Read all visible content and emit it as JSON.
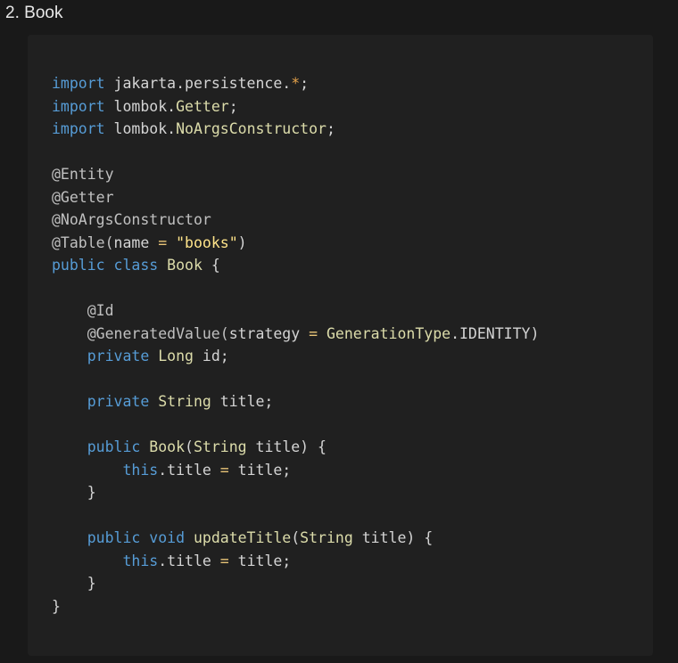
{
  "heading": {
    "number": "2.",
    "title": "Book"
  },
  "colors": {
    "background": "#191919",
    "code_background": "#202020",
    "keyword": "#569cd6",
    "type": "#dcdcaa",
    "plain": "#d4d4d4",
    "string": "#ffe48a"
  },
  "code": {
    "language": "java",
    "lines": [
      [
        {
          "t": "import",
          "k": "kw"
        },
        {
          "t": " jakarta.persistence.",
          "k": "plain"
        },
        {
          "t": "*",
          "k": "star"
        },
        {
          "t": ";",
          "k": "plain"
        }
      ],
      [
        {
          "t": "import",
          "k": "kw"
        },
        {
          "t": " lombok.",
          "k": "plain"
        },
        {
          "t": "Getter",
          "k": "type"
        },
        {
          "t": ";",
          "k": "plain"
        }
      ],
      [
        {
          "t": "import",
          "k": "kw"
        },
        {
          "t": " lombok.",
          "k": "plain"
        },
        {
          "t": "NoArgsConstructor",
          "k": "type"
        },
        {
          "t": ";",
          "k": "plain"
        }
      ],
      [],
      [
        {
          "t": "@Entity",
          "k": "ann"
        }
      ],
      [
        {
          "t": "@Getter",
          "k": "ann"
        }
      ],
      [
        {
          "t": "@NoArgsConstructor",
          "k": "ann"
        }
      ],
      [
        {
          "t": "@Table(",
          "k": "ann"
        },
        {
          "t": "name",
          "k": "plain"
        },
        {
          "t": " = ",
          "k": "op"
        },
        {
          "t": "\"books\"",
          "k": "str"
        },
        {
          "t": ")",
          "k": "plain"
        }
      ],
      [
        {
          "t": "public class ",
          "k": "kw"
        },
        {
          "t": "Book",
          "k": "type"
        },
        {
          "t": " {",
          "k": "plain"
        }
      ],
      [],
      [
        {
          "t": "    @Id",
          "k": "ann"
        }
      ],
      [
        {
          "t": "    @GeneratedValue(",
          "k": "ann"
        },
        {
          "t": "strategy",
          "k": "plain"
        },
        {
          "t": " = ",
          "k": "op"
        },
        {
          "t": "GenerationType",
          "k": "type"
        },
        {
          "t": ".IDENTITY)",
          "k": "plain"
        }
      ],
      [
        {
          "t": "    private ",
          "k": "kw"
        },
        {
          "t": "Long",
          "k": "type"
        },
        {
          "t": " id;",
          "k": "plain"
        }
      ],
      [],
      [
        {
          "t": "    private ",
          "k": "kw"
        },
        {
          "t": "String",
          "k": "type"
        },
        {
          "t": " title;",
          "k": "plain"
        }
      ],
      [],
      [
        {
          "t": "    public ",
          "k": "kw"
        },
        {
          "t": "Book",
          "k": "type"
        },
        {
          "t": "(",
          "k": "plain"
        },
        {
          "t": "String",
          "k": "type"
        },
        {
          "t": " title) {",
          "k": "plain"
        }
      ],
      [
        {
          "t": "        this",
          "k": "kw"
        },
        {
          "t": ".title ",
          "k": "plain"
        },
        {
          "t": "=",
          "k": "op"
        },
        {
          "t": " title;",
          "k": "plain"
        }
      ],
      [
        {
          "t": "    }",
          "k": "plain"
        }
      ],
      [],
      [
        {
          "t": "    public void ",
          "k": "kw"
        },
        {
          "t": "updateTitle",
          "k": "type"
        },
        {
          "t": "(",
          "k": "plain"
        },
        {
          "t": "String",
          "k": "type"
        },
        {
          "t": " title) {",
          "k": "plain"
        }
      ],
      [
        {
          "t": "        this",
          "k": "kw"
        },
        {
          "t": ".title ",
          "k": "plain"
        },
        {
          "t": "=",
          "k": "op"
        },
        {
          "t": " title;",
          "k": "plain"
        }
      ],
      [
        {
          "t": "    }",
          "k": "plain"
        }
      ],
      [
        {
          "t": "}",
          "k": "plain"
        }
      ]
    ]
  }
}
